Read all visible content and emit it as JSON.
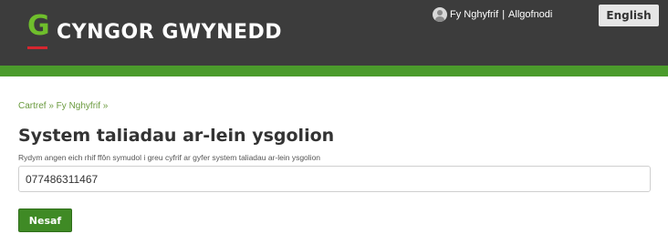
{
  "header": {
    "logo_text": "CYNGOR GWYNEDD",
    "account_link": "Fy Nghyfrif",
    "separator": "|",
    "logout_link": "Allgofnodi",
    "language_button": "English"
  },
  "colors": {
    "header_bg": "#3c3c3c",
    "accent_green": "#4b9b2c",
    "button_green": "#3f8a25"
  },
  "breadcrumb": "Cartref » Fy Nghyfrif »",
  "page": {
    "title": "System taliadau ar-lein ysgolion",
    "help_text": "Rydym angen eich rhif ffôn symudol i greu cyfrif ar gyfer system taliadau ar-lein ysgolion",
    "phone_value": "077486311467",
    "next_button": "Nesaf"
  }
}
